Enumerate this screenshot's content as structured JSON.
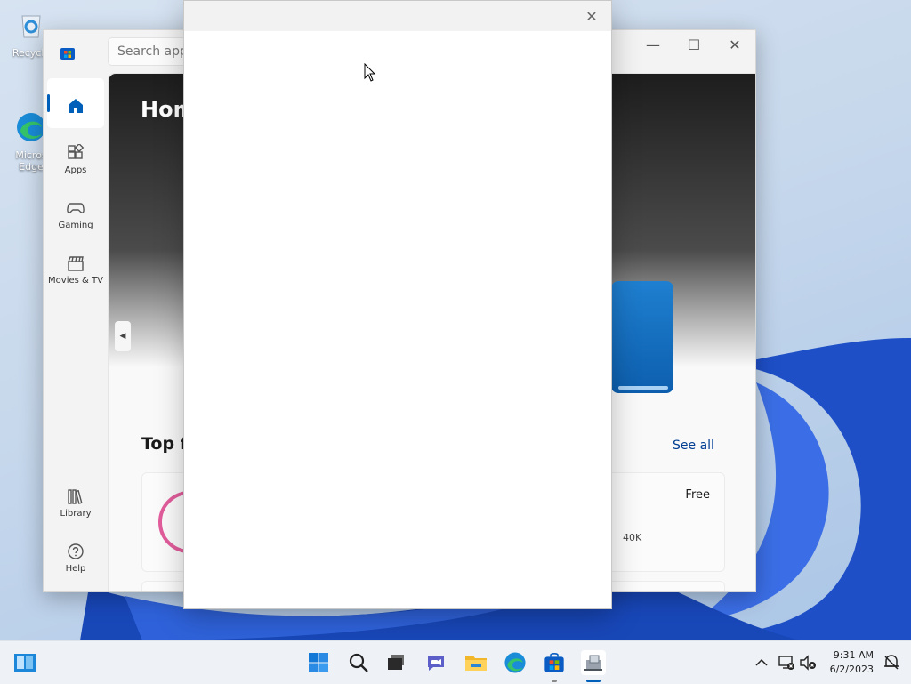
{
  "desktop": {
    "icons": [
      {
        "label": "Recycle",
        "icon": "recycle-bin-icon"
      },
      {
        "label": "Micros\nEdge",
        "icon": "edge-icon"
      }
    ]
  },
  "store": {
    "search_placeholder": "Search apps",
    "controls": {
      "minimize": "—",
      "maximize": "☐",
      "close": "✕"
    },
    "nav": [
      {
        "label": "",
        "icon": "home-icon",
        "active": true
      },
      {
        "label": "Apps",
        "icon": "apps-icon"
      },
      {
        "label": "Gaming",
        "icon": "gamepad-icon"
      },
      {
        "label": "Movies & TV",
        "icon": "clapperboard-icon"
      },
      {
        "label": "Library",
        "icon": "library-icon"
      },
      {
        "label": "Help",
        "icon": "help-icon"
      }
    ],
    "hero_title": "Hom",
    "section_title": "Top fr",
    "see_all": "See all",
    "card": {
      "price": "Free",
      "ratings": "40K"
    }
  },
  "dialog": {
    "close_glyph": "✕"
  },
  "taskbar": {
    "apps": [
      "start-icon",
      "search-icon",
      "task-view-icon",
      "teams-chat-icon",
      "file-explorer-icon",
      "edge-icon",
      "store-icon",
      "installer-icon"
    ],
    "time": "9:31 AM",
    "date": "6/2/2023"
  },
  "colors": {
    "accent": "#005fb8",
    "link": "#003e92"
  }
}
